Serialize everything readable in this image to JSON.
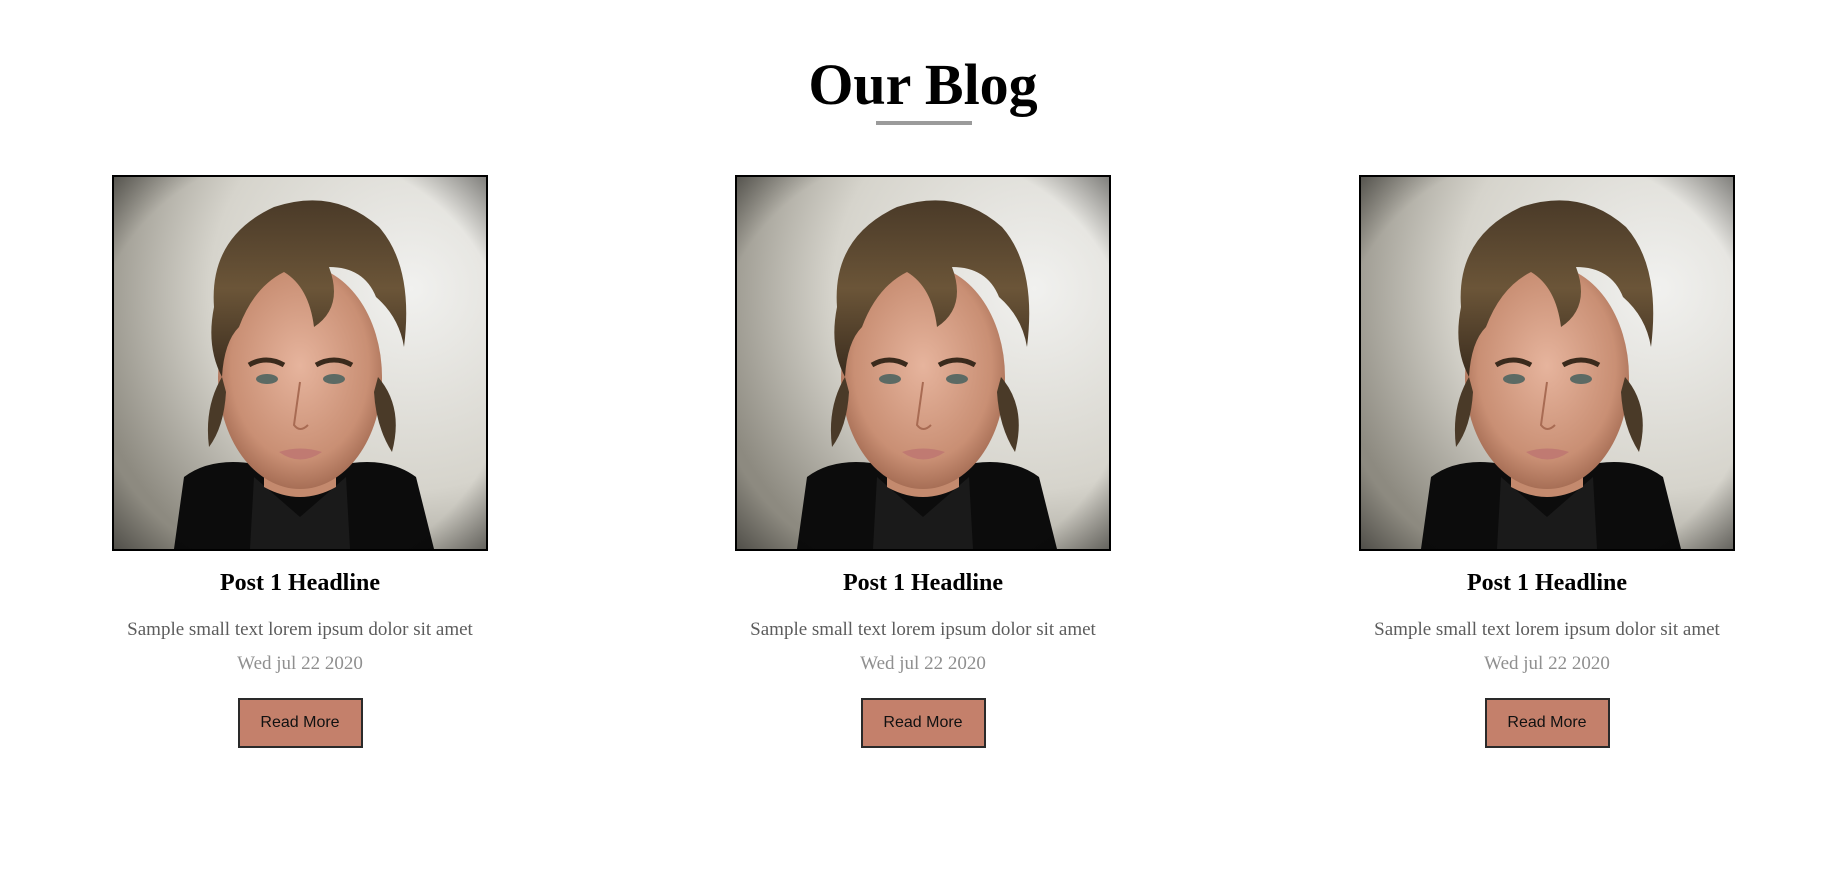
{
  "blog": {
    "title": "Our Blog",
    "posts": [
      {
        "headline": "Post 1 Headline",
        "excerpt": "Sample small text lorem ipsum dolor sit amet",
        "date": "Wed jul 22 2020",
        "button_label": "Read More"
      },
      {
        "headline": "Post 1 Headline",
        "excerpt": "Sample small text lorem ipsum dolor sit amet",
        "date": "Wed jul 22 2020",
        "button_label": "Read More"
      },
      {
        "headline": "Post 1 Headline",
        "excerpt": "Sample small text lorem ipsum dolor sit amet",
        "date": "Wed jul 22 2020",
        "button_label": "Read More"
      }
    ]
  },
  "colors": {
    "button_bg": "#c4806b",
    "underline": "#9b9b9b",
    "excerpt_text": "#5c5c5c",
    "date_text": "#8f8f8f"
  },
  "images": {
    "post_image": "portrait-photo"
  }
}
